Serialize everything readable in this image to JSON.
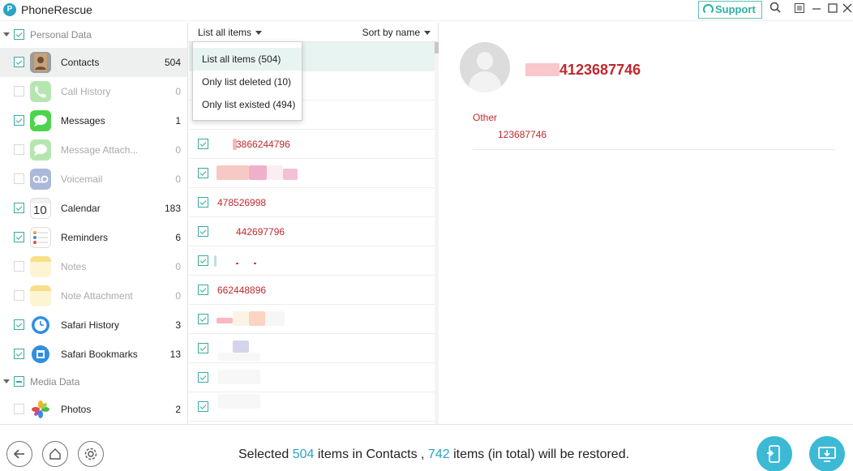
{
  "app": {
    "title": "PhoneRescue",
    "logo_letter": "P"
  },
  "titlebar": {
    "support_label": "Support"
  },
  "sidebar": {
    "groups": [
      {
        "label": "Personal Data"
      },
      {
        "label": "Media Data"
      }
    ],
    "items": [
      {
        "label": "Contacts",
        "count": "504",
        "checked": true,
        "enabled": true,
        "icon": "contacts-icon"
      },
      {
        "label": "Call History",
        "count": "0",
        "checked": false,
        "enabled": false,
        "icon": "phone-icon"
      },
      {
        "label": "Messages",
        "count": "1",
        "checked": true,
        "enabled": true,
        "icon": "messages-icon"
      },
      {
        "label": "Message Attach...",
        "count": "0",
        "checked": false,
        "enabled": false,
        "icon": "message-attachment-icon"
      },
      {
        "label": "Voicemail",
        "count": "0",
        "checked": false,
        "enabled": false,
        "icon": "voicemail-icon"
      },
      {
        "label": "Calendar",
        "count": "183",
        "checked": true,
        "enabled": true,
        "icon": "calendar-icon",
        "icon_text": "10"
      },
      {
        "label": "Reminders",
        "count": "6",
        "checked": true,
        "enabled": true,
        "icon": "reminders-icon"
      },
      {
        "label": "Notes",
        "count": "0",
        "checked": false,
        "enabled": false,
        "icon": "notes-icon"
      },
      {
        "label": "Note Attachment",
        "count": "0",
        "checked": false,
        "enabled": false,
        "icon": "note-attachment-icon"
      },
      {
        "label": "Safari History",
        "count": "3",
        "checked": true,
        "enabled": true,
        "icon": "safari-history-icon"
      },
      {
        "label": "Safari Bookmarks",
        "count": "13",
        "checked": true,
        "enabled": true,
        "icon": "safari-bookmarks-icon"
      },
      {
        "label": "Photos",
        "count": "2",
        "checked": false,
        "enabled": true,
        "icon": "photos-icon"
      }
    ]
  },
  "list": {
    "filter_label": "List all items",
    "sort_label": "Sort by name",
    "rows": [
      {
        "text": ""
      },
      {
        "text": ""
      },
      {
        "text": ""
      },
      {
        "text": "3866244796"
      },
      {
        "text": ""
      },
      {
        "text": "478526998"
      },
      {
        "text": "442697796"
      },
      {
        "text": ""
      },
      {
        "text": "662448896"
      },
      {
        "text": ""
      },
      {
        "text": ""
      },
      {
        "text": ""
      },
      {
        "text": ""
      }
    ]
  },
  "dropdown": {
    "options": [
      {
        "label": "List all items (504)"
      },
      {
        "label": "Only list deleted (10)"
      },
      {
        "label": "Only list existed (494)"
      }
    ]
  },
  "detail": {
    "name": "4123687746",
    "field_label": "Other",
    "field_value": "123687746"
  },
  "footer": {
    "status_prefix": "Selected ",
    "selected_count": "504",
    "status_middle": " items in Contacts , ",
    "total_count": "742",
    "status_suffix": " items (in total) will be restored."
  },
  "colors": {
    "accent": "#3ba99d",
    "highlight": "#c0282d",
    "button": "#3cb9d5"
  }
}
